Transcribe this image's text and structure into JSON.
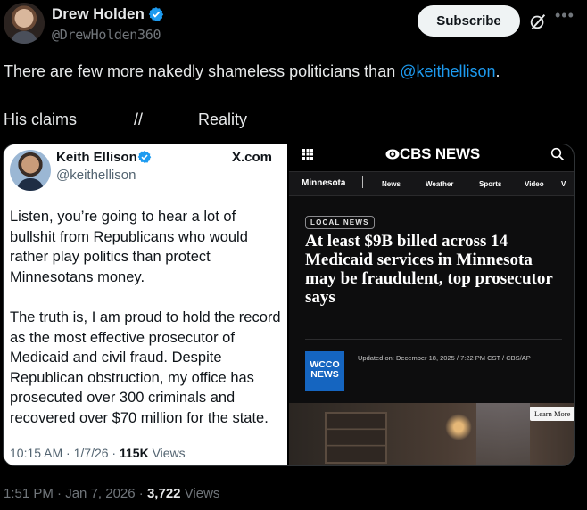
{
  "author": {
    "name": "Drew Holden",
    "handle": "@DrewHolden360"
  },
  "actions": {
    "subscribe_label": "Subscribe",
    "grok_icon": "grok-slash-circle-icon",
    "more_icon": "ellipsis-icon"
  },
  "tweet": {
    "text_before": "There are few more nakedly shameless politicians than ",
    "mention": "@keithellison",
    "text_after": ".",
    "claims_label": "His claims",
    "separator": "//",
    "reality_label": "Reality"
  },
  "embedded_post": {
    "name": "Keith Ellison",
    "handle": "@keithellison",
    "source": "X.com",
    "paragraphs": [
      "Listen, you’re going to hear a lot of bullshit from Republicans who would rather play politics than protect Minnesotans money.",
      "The truth is, I am proud to hold the record as the most effective prosecutor of Medicaid and civil fraud. Despite Republican obstruction, my office has prosecuted over 300 criminals and recovered over $70 million for the state."
    ],
    "time": "10:15 AM",
    "date": "1/7/26",
    "views_count": "115K",
    "views_label": "Views"
  },
  "news": {
    "logo": "CBS NEWS",
    "nav_region": "Minnesota",
    "nav_items": [
      "News",
      "Weather",
      "Sports",
      "Video",
      "V"
    ],
    "badge": "LOCAL NEWS",
    "headline": "At least $9B billed across 14 Medicaid services in Minnesota may be fraudulent, top prosecutor says",
    "station_logo_line1": "WCCO",
    "station_logo_line2": "NEWS",
    "updated": "Updated on: December 18, 2025 / 7:22 PM CST / CBS/AP",
    "learn_more": "Learn More"
  },
  "footer": {
    "time": "1:51 PM",
    "date": "Jan 7, 2026",
    "views_count": "3,722",
    "views_label": "Views"
  },
  "colors": {
    "background": "#000000",
    "accent_link": "#1d9bf0",
    "verified_blue": "#1d9bf0",
    "station_blue": "#1565c0"
  }
}
